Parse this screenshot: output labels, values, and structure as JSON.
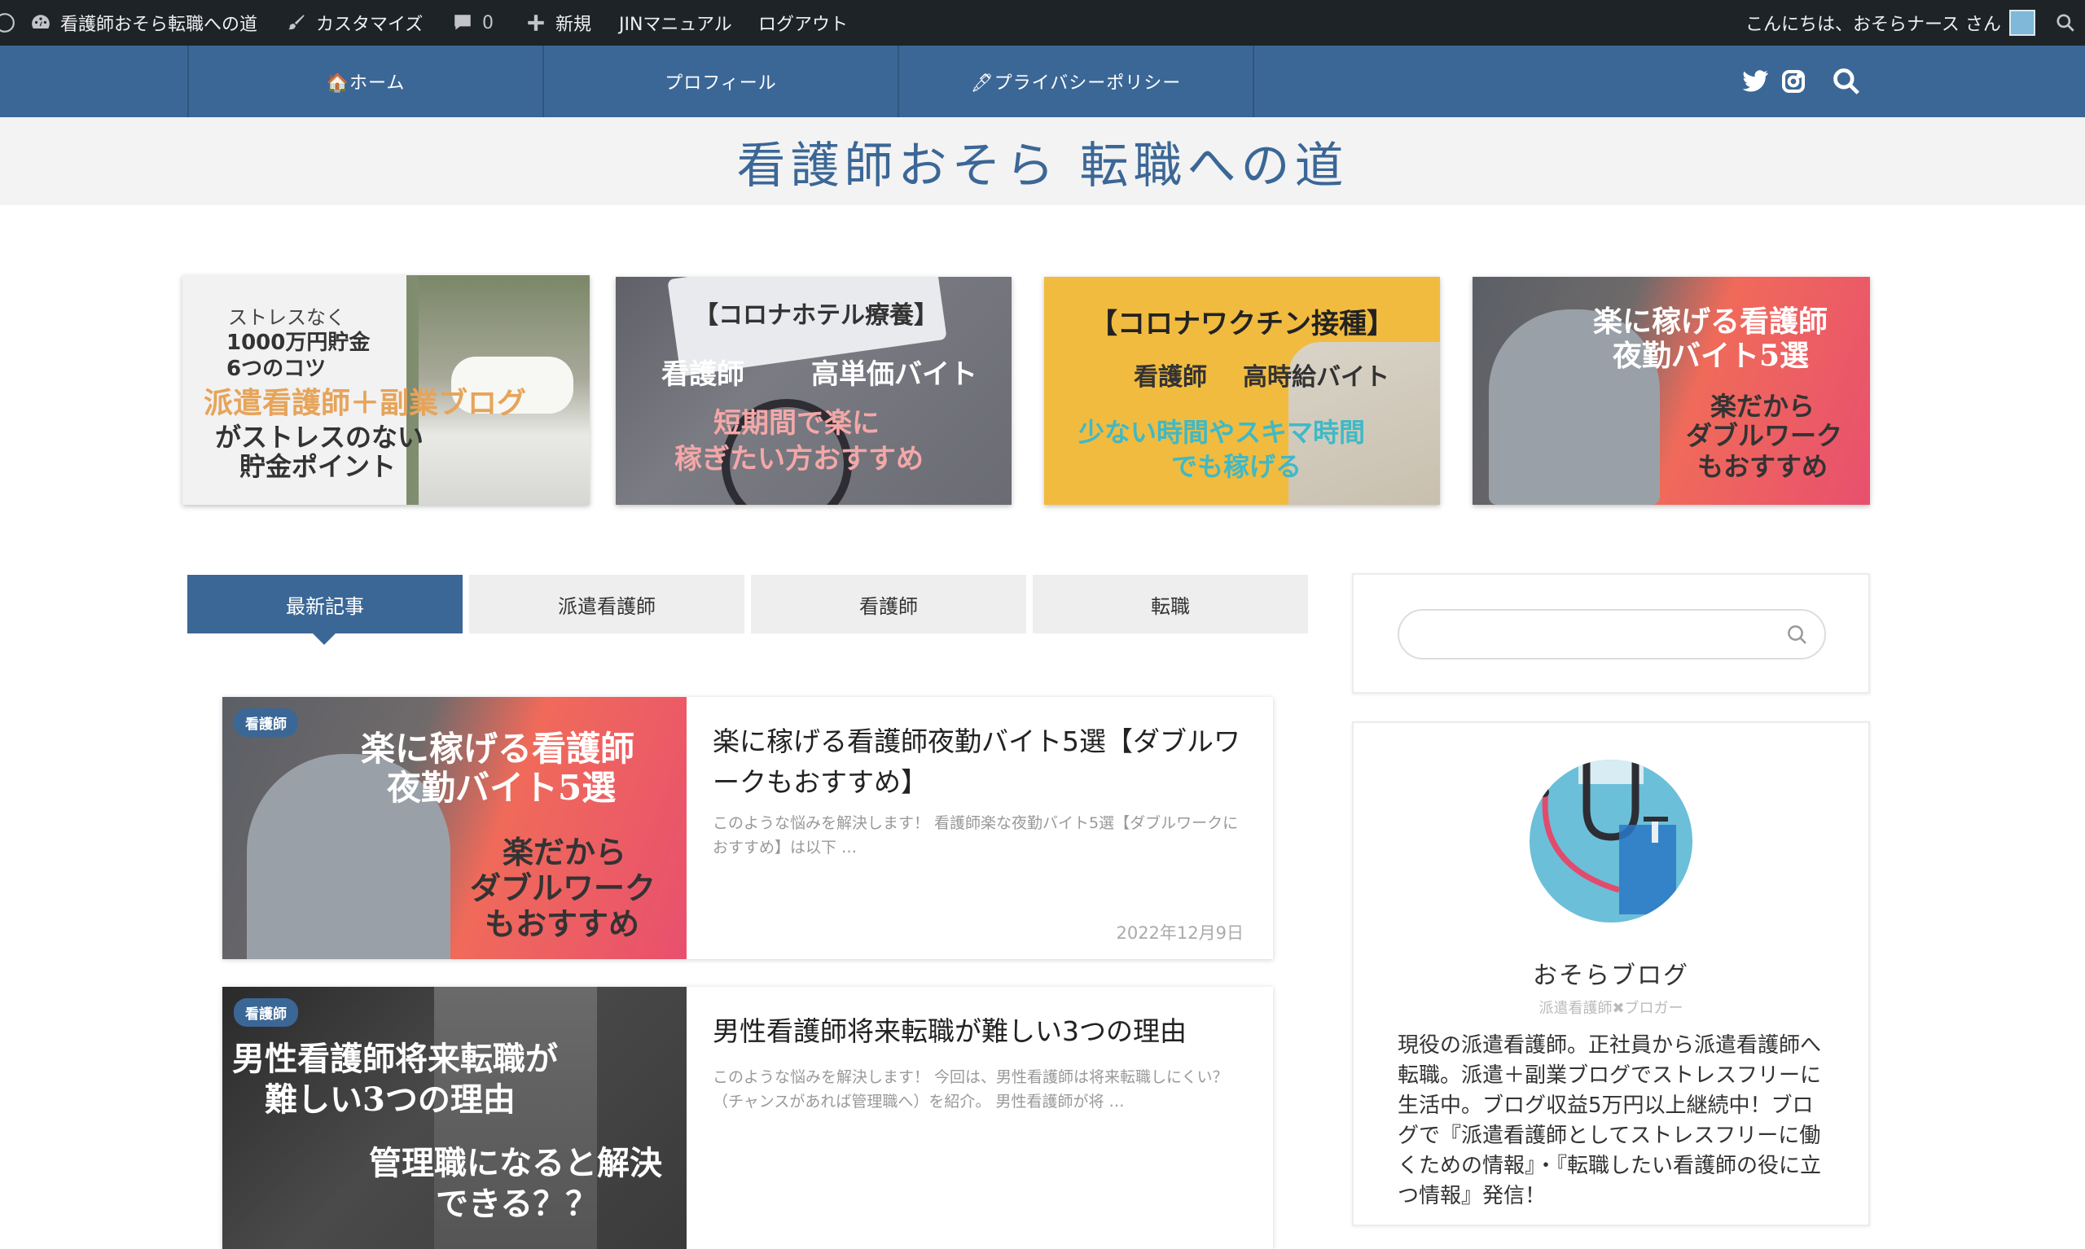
{
  "adminbar": {
    "site_name": "看護師おそら転職への道",
    "customize": "カスタマイズ",
    "comments_count": "0",
    "new": "新規",
    "manual": "JINマニュアル",
    "logout": "ログアウト",
    "greeting": "こんにちは、おそらナース さん"
  },
  "nav": {
    "items": [
      {
        "label": "🏠ホーム"
      },
      {
        "label": "プロフィール"
      },
      {
        "label": "🖋プライバシーポリシー"
      }
    ],
    "icons": [
      "twitter-icon",
      "instagram-icon",
      "search-icon"
    ]
  },
  "header": {
    "title": "看護師おそら 転職への道"
  },
  "banners": [
    {
      "lines": [
        "ストレスなく",
        "1000万円貯金",
        "6つのコツ",
        "派遣看護師＋副業ブログ",
        "がストレスのない",
        "貯金ポイント"
      ]
    },
    {
      "lines": [
        "【コロナホテル療養】",
        "看護師",
        "高単価バイト",
        "短期間で楽に",
        "稼ぎたい方おすすめ"
      ]
    },
    {
      "lines": [
        "【コロナワクチン接種】",
        "看護師",
        "高時給バイト",
        "少ない時間やスキマ時間",
        "でも稼げる"
      ]
    },
    {
      "lines": [
        "楽に稼げる看護師",
        "夜勤バイト5選",
        "楽だから",
        "ダブルワーク",
        "もおすすめ"
      ]
    }
  ],
  "tabs": [
    {
      "label": "最新記事"
    },
    {
      "label": "派遣看護師"
    },
    {
      "label": "看護師"
    },
    {
      "label": "転職"
    }
  ],
  "articles": [
    {
      "category": "看護師",
      "thumb_lines": [
        "楽に稼げる看護師",
        "夜勤バイト5選",
        "楽だから",
        "ダブルワーク",
        "もおすすめ"
      ],
      "title": "楽に稼げる看護師夜勤バイト5選【ダブルワークもおすすめ】",
      "excerpt": "このような悩みを解決します！ 看護師楽な夜勤バイト5選【ダブルワークにおすすめ】は以下 …",
      "date": "2022年12月9日"
    },
    {
      "category": "看護師",
      "thumb_lines": [
        "男性看護師将来転職が",
        "難しい3つの理由",
        "管理職になると解決",
        "できる？？"
      ],
      "title": "男性看護師将来転職が難しい3つの理由",
      "excerpt": "このような悩みを解決します！ 今回は、男性看護師は将来転職しにくい？（チャンスがあれば管理職へ）を紹介。 男性看護師が将 …",
      "date": ""
    }
  ],
  "sidebar": {
    "search": {
      "placeholder": ""
    },
    "profile": {
      "name": "おそらブログ",
      "role": "派遣看護師✖ブロガー",
      "bio": "現役の派遣看護師。正社員から派遣看護師へ転職。派遣＋副業ブログでストレスフリーに生活中。ブログ収益5万円以上継続中！ブログで『派遣看護師としてストレスフリーに働くための情報』・『転職したい看護師の役に立つ情報』発信！"
    }
  },
  "colors": {
    "accent": "#3b6796",
    "adminbar": "#1d2327",
    "header_bg": "#f3f3f3"
  }
}
